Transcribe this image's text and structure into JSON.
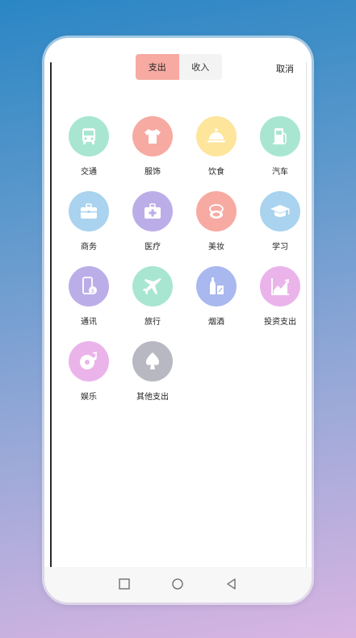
{
  "tabs": {
    "expense": "支出",
    "income": "收入",
    "active": "expense"
  },
  "cancel_label": "取消",
  "categories": [
    {
      "label": "交通",
      "icon": "bus-icon",
      "color": "#a8e6d2"
    },
    {
      "label": "服饰",
      "icon": "tshirt-icon",
      "color": "#f7aaa2"
    },
    {
      "label": "饮食",
      "icon": "food-cloche-icon",
      "color": "#fde59b"
    },
    {
      "label": "汽车",
      "icon": "fuel-pump-icon",
      "color": "#a8e6d2"
    },
    {
      "label": "商务",
      "icon": "briefcase-icon",
      "color": "#a9d3ee"
    },
    {
      "label": "医疗",
      "icon": "medical-kit-icon",
      "color": "#bbaee8"
    },
    {
      "label": "美妆",
      "icon": "cosmetics-icon",
      "color": "#f7aaa2"
    },
    {
      "label": "学习",
      "icon": "graduation-cap-icon",
      "color": "#a9d3ee"
    },
    {
      "label": "通讯",
      "icon": "phone-icon",
      "color": "#bbaee8"
    },
    {
      "label": "旅行",
      "icon": "airplane-icon",
      "color": "#a8e6d2"
    },
    {
      "label": "烟酒",
      "icon": "bottle-icon",
      "color": "#a9b8ee"
    },
    {
      "label": "投资支出",
      "icon": "chart-line-icon",
      "color": "#eab4ea"
    },
    {
      "label": "娱乐",
      "icon": "music-disc-icon",
      "color": "#eab4ea"
    },
    {
      "label": "其他支出",
      "icon": "spade-icon",
      "color": "#b8b8c2"
    }
  ]
}
